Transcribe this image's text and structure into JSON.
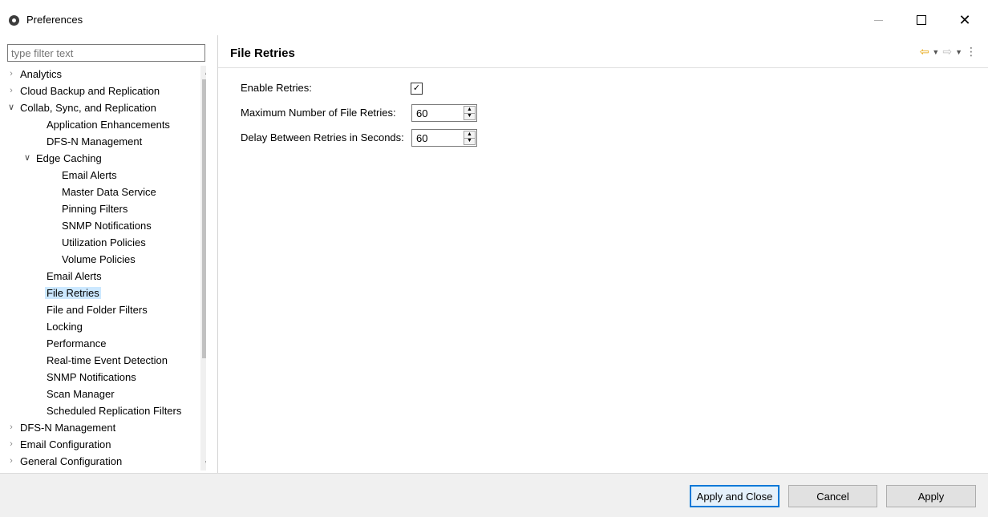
{
  "window": {
    "title": "Preferences",
    "app_icon": "preferences-gear-icon"
  },
  "filter": {
    "placeholder": "type filter text"
  },
  "tree": {
    "items": [
      {
        "label": "Analytics",
        "expander": "collapsed"
      },
      {
        "label": "Cloud Backup and Replication",
        "expander": "collapsed"
      },
      {
        "label": "Collab, Sync, and Replication",
        "expander": "expanded"
      },
      {
        "label": "Application Enhancements"
      },
      {
        "label": "DFS-N Management"
      },
      {
        "label": "Edge Caching",
        "expander": "expanded"
      },
      {
        "label": "Email Alerts"
      },
      {
        "label": "Master Data Service"
      },
      {
        "label": "Pinning Filters"
      },
      {
        "label": "SNMP Notifications"
      },
      {
        "label": "Utilization Policies"
      },
      {
        "label": "Volume Policies"
      },
      {
        "label": "Email Alerts"
      },
      {
        "label": "File Retries",
        "selected": true
      },
      {
        "label": "File and Folder Filters"
      },
      {
        "label": "Locking"
      },
      {
        "label": "Performance"
      },
      {
        "label": "Real-time Event Detection"
      },
      {
        "label": "SNMP Notifications"
      },
      {
        "label": "Scan Manager"
      },
      {
        "label": "Scheduled Replication Filters"
      },
      {
        "label": "DFS-N Management",
        "expander": "collapsed"
      },
      {
        "label": "Email Configuration",
        "expander": "collapsed"
      },
      {
        "label": "General Configuration",
        "expander": "collapsed"
      }
    ]
  },
  "page": {
    "title": "File Retries",
    "fields": {
      "enable_retries": {
        "label": "Enable Retries:",
        "checked": true
      },
      "max_retries": {
        "label": "Maximum Number of File Retries:",
        "value": "60"
      },
      "delay": {
        "label": "Delay Between Retries in Seconds:",
        "value": "60"
      }
    }
  },
  "buttons": {
    "apply_close": "Apply and Close",
    "cancel": "Cancel",
    "apply": "Apply"
  },
  "colors": {
    "selection": "#cce8ff",
    "default_button_border": "#0078d7",
    "back_arrow": "#e6a100"
  }
}
